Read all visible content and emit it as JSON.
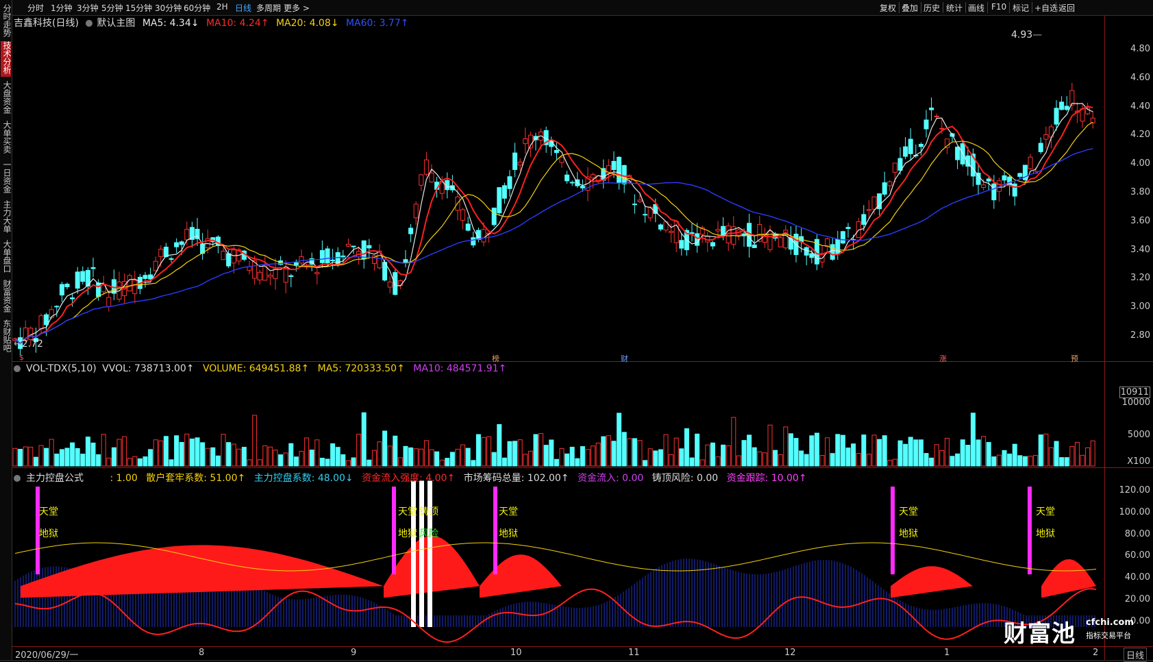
{
  "toolbar": {
    "timeframes": [
      "分时",
      "1分钟",
      "3分钟",
      "5分钟",
      "15分钟",
      "30分钟",
      "60分钟",
      "2H",
      "日线",
      "多周期",
      "更多 >"
    ],
    "active_timeframe": "日线",
    "right_buttons": [
      "复权",
      "叠加",
      "历史",
      "统计",
      "画线",
      "F10",
      "标记",
      "+自选",
      "返回"
    ]
  },
  "left_tabs": [
    "分时走势",
    "技术分析",
    "大盘资金",
    "大单买卖",
    "一日资金",
    "主力大单",
    "大单盘口",
    "财富资金",
    "东财贴吧"
  ],
  "active_left_tab": "技术分析",
  "main_chart": {
    "stock_title": "吉鑫科技(日线)",
    "template": "默认主图",
    "ma5": "MA5: 4.34↓",
    "ma10": "MA10: 4.24↑",
    "ma20": "MA20: 4.08↓",
    "ma60": "MA60: 3.77↑",
    "high_mark": "4.93",
    "low_mark": "2.72",
    "price_axis": [
      "4.80",
      "4.60",
      "4.40",
      "4.20",
      "4.00",
      "3.80",
      "3.60",
      "3.40",
      "3.20",
      "3.00",
      "2.80"
    ],
    "event_tags": [
      "$",
      "榜",
      "财",
      "涨",
      "预"
    ]
  },
  "volume_panel": {
    "name": "VOL-TDX(5,10)",
    "vvol": "VVOL: 738713.00↑",
    "volume": "VOLUME: 649451.88↑",
    "ma5": "MA5: 720333.50↑",
    "ma10": "MA10: 484571.91↑",
    "axis": [
      "10911",
      "10000",
      "5000",
      "X100"
    ]
  },
  "indicator_panel": {
    "name": "主力控盘公式",
    "p1": ": 1.00",
    "p2": "散户套牢系数: 51.00↑",
    "p3": "主力控盘系数: 48.00↓",
    "p4": "资金流入强度: 4.00↑",
    "p5": "市场筹码总量: 102.00↑",
    "p6": "资金流入: 0.00",
    "p7": "铸顶风险: 0.00",
    "p8": "资金跟踪: 10.00↑",
    "axis": [
      "120.00",
      "100.00",
      "80.00",
      "60.00",
      "40.00",
      "20.00",
      "0.00"
    ],
    "signal_heaven": "天堂",
    "signal_hell": "地狱",
    "signal_top": "铸顶",
    "signal_risk": "风险"
  },
  "date_axis": {
    "start": "2020/06/29/一",
    "months": [
      "8",
      "9",
      "10",
      "11",
      "12",
      "1",
      "2"
    ],
    "period": "日线"
  },
  "logo": {
    "name": "财富池",
    "url": "cfchi.com",
    "tagline": "指标交易平台"
  }
}
